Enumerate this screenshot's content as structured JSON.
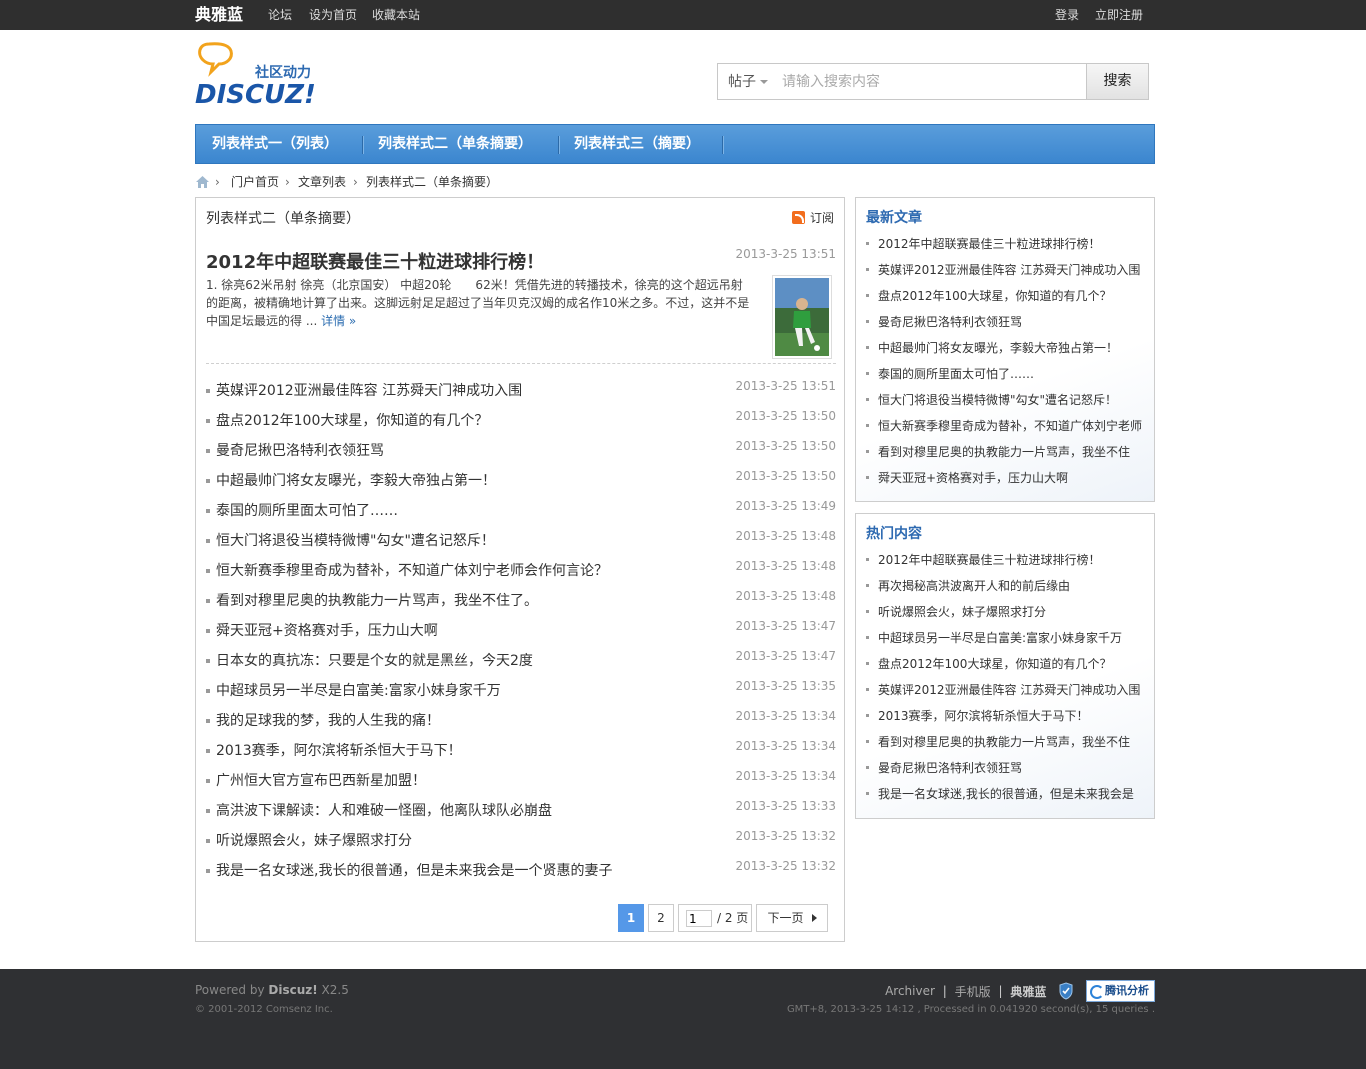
{
  "topbar": {
    "brand": "典雅蓝",
    "links": [
      "论坛",
      "设为首页",
      "收藏本站"
    ],
    "login": "登录",
    "register": "立即注册"
  },
  "header": {
    "logo_slogan": "社区动力",
    "logo_text": "DISCUZ!",
    "search": {
      "scope": "帖子",
      "placeholder": "请输入搜索内容",
      "button": "搜索"
    }
  },
  "nav": {
    "items": [
      "列表样式一（列表）",
      "列表样式二（单条摘要）",
      "列表样式三（摘要）"
    ]
  },
  "breadcrumb": [
    "门户首页",
    "文章列表",
    "列表样式二（单条摘要）"
  ],
  "main": {
    "heading": "列表样式二（单条摘要）",
    "subscribe": "订阅",
    "featured": {
      "title": "2012年中超联赛最佳三十粒进球排行榜！",
      "date": "2013-3-25 13:51",
      "summary": "1. 徐亮62米吊射 徐亮（北京国安） 中超20轮　　62米！凭借先进的转播技术，徐亮的这个超远吊射的距离，被精确地计算了出来。这脚远射足足超过了当年贝克汉姆的成名作10米之多。不过，这并不是中国足坛最远的得 ...",
      "more": "详情 »"
    },
    "articles": [
      {
        "title": "英媒评2012亚洲最佳阵容 江苏舜天门神成功入围",
        "date": "2013-3-25 13:51"
      },
      {
        "title": "盘点2012年100大球星，你知道的有几个？",
        "date": "2013-3-25 13:50"
      },
      {
        "title": "曼奇尼揪巴洛特利衣领狂骂",
        "date": "2013-3-25 13:50"
      },
      {
        "title": "中超最帅门将女友曝光，李毅大帝独占第一！",
        "date": "2013-3-25 13:50"
      },
      {
        "title": "泰国的厕所里面太可怕了……",
        "date": "2013-3-25 13:49"
      },
      {
        "title": "恒大门将退役当模特微博\"勾女\"遭名记怒斥！",
        "date": "2013-3-25 13:48"
      },
      {
        "title": "恒大新赛季穆里奇成为替补，不知道广体刘宁老师会作何言论？",
        "date": "2013-3-25 13:48"
      },
      {
        "title": "看到对穆里尼奥的执教能力一片骂声，我坐不住了。",
        "date": "2013-3-25 13:48"
      },
      {
        "title": "舜天亚冠+资格赛对手，压力山大啊",
        "date": "2013-3-25 13:47"
      },
      {
        "title": "日本女的真抗冻：只要是个女的就是黑丝，今天2度",
        "date": "2013-3-25 13:47"
      },
      {
        "title": "中超球员另一半尽是白富美:富家小妹身家千万",
        "date": "2013-3-25 13:35"
      },
      {
        "title": "我的足球我的梦，我的人生我的痛！",
        "date": "2013-3-25 13:34"
      },
      {
        "title": "2013赛季，阿尔滨将斩杀恒大于马下！",
        "date": "2013-3-25 13:34"
      },
      {
        "title": "广州恒大官方宣布巴西新星加盟！",
        "date": "2013-3-25 13:34"
      },
      {
        "title": "高洪波下课解读：人和难破一怪圈，他离队球队必崩盘",
        "date": "2013-3-25 13:33"
      },
      {
        "title": "听说爆照会火，妹子爆照求打分",
        "date": "2013-3-25 13:32"
      },
      {
        "title": "我是一名女球迷,我长的很普通，但是未来我会是一个贤惠的妻子",
        "date": "2013-3-25 13:32"
      }
    ],
    "pager": {
      "current": "1",
      "page2": "2",
      "input_value": "1",
      "total": "/ 2 页",
      "next": "下一页"
    }
  },
  "sidebar": {
    "latest": {
      "title": "最新文章",
      "items": [
        "2012年中超联赛最佳三十粒进球排行榜！",
        "英媒评2012亚洲最佳阵容 江苏舜天门神成功入围",
        "盘点2012年100大球星，你知道的有几个？",
        "曼奇尼揪巴洛特利衣领狂骂",
        "中超最帅门将女友曝光，李毅大帝独占第一！",
        "泰国的厕所里面太可怕了……",
        "恒大门将退役当模特微博\"勾女\"遭名记怒斥！",
        "恒大新赛季穆里奇成为替补，不知道广体刘宁老师",
        "看到对穆里尼奥的执教能力一片骂声，我坐不住",
        "舜天亚冠+资格赛对手，压力山大啊"
      ]
    },
    "hot": {
      "title": "热门内容",
      "items": [
        "2012年中超联赛最佳三十粒进球排行榜！",
        "再次揭秘高洪波离开人和的前后缘由",
        "听说爆照会火，妹子爆照求打分",
        "中超球员另一半尽是白富美:富家小妹身家千万",
        "盘点2012年100大球星，你知道的有几个？",
        "英媒评2012亚洲最佳阵容 江苏舜天门神成功入围",
        "2013赛季，阿尔滨将斩杀恒大于马下！",
        "看到对穆里尼奥的执教能力一片骂声，我坐不住",
        "曼奇尼揪巴洛特利衣领狂骂",
        "我是一名女球迷,我长的很普通，但是未来我会是"
      ]
    }
  },
  "footer": {
    "powered_prefix": "Powered by ",
    "powered_name": "Discuz!",
    "powered_version": " X2.5",
    "copyright": "© 2001-2012 Comsenz Inc.",
    "links": [
      "Archiver",
      "手机版",
      "典雅蓝"
    ],
    "stats_label": "腾讯分析",
    "gmt": "GMT+8, 2013-3-25 14:12 , Processed in 0.041920 second(s), 15 queries ."
  },
  "colors": {
    "nav_bg": "#3b86cf",
    "sidebar_title": "#2e6ab1",
    "pager_current": "#5598e8",
    "topbar_bg": "#2f2f2f",
    "footer_bg": "#2f3033"
  }
}
